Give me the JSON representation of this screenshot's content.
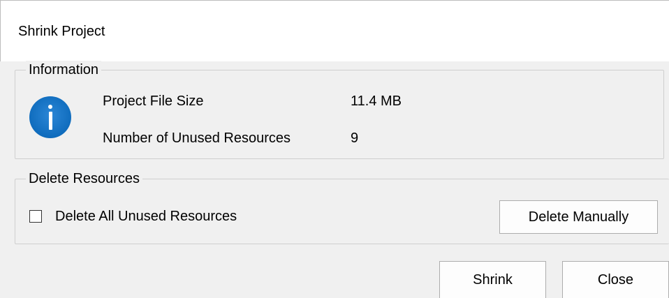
{
  "dialog": {
    "title": "Shrink Project"
  },
  "information": {
    "group_label": "Information",
    "icon": "info-icon",
    "rows": [
      {
        "label": "Project File Size",
        "value": "11.4 MB"
      },
      {
        "label": "Number of Unused Resources",
        "value": "9"
      }
    ]
  },
  "delete_resources": {
    "group_label": "Delete Resources",
    "checkbox_label": "Delete All Unused Resources",
    "checkbox_checked": false,
    "delete_manually_label": "Delete Manually"
  },
  "footer": {
    "shrink_label": "Shrink",
    "close_label": "Close"
  },
  "colors": {
    "accent": "#0f6cbd",
    "background": "#f0f0f0",
    "title_background": "#ffffff"
  }
}
